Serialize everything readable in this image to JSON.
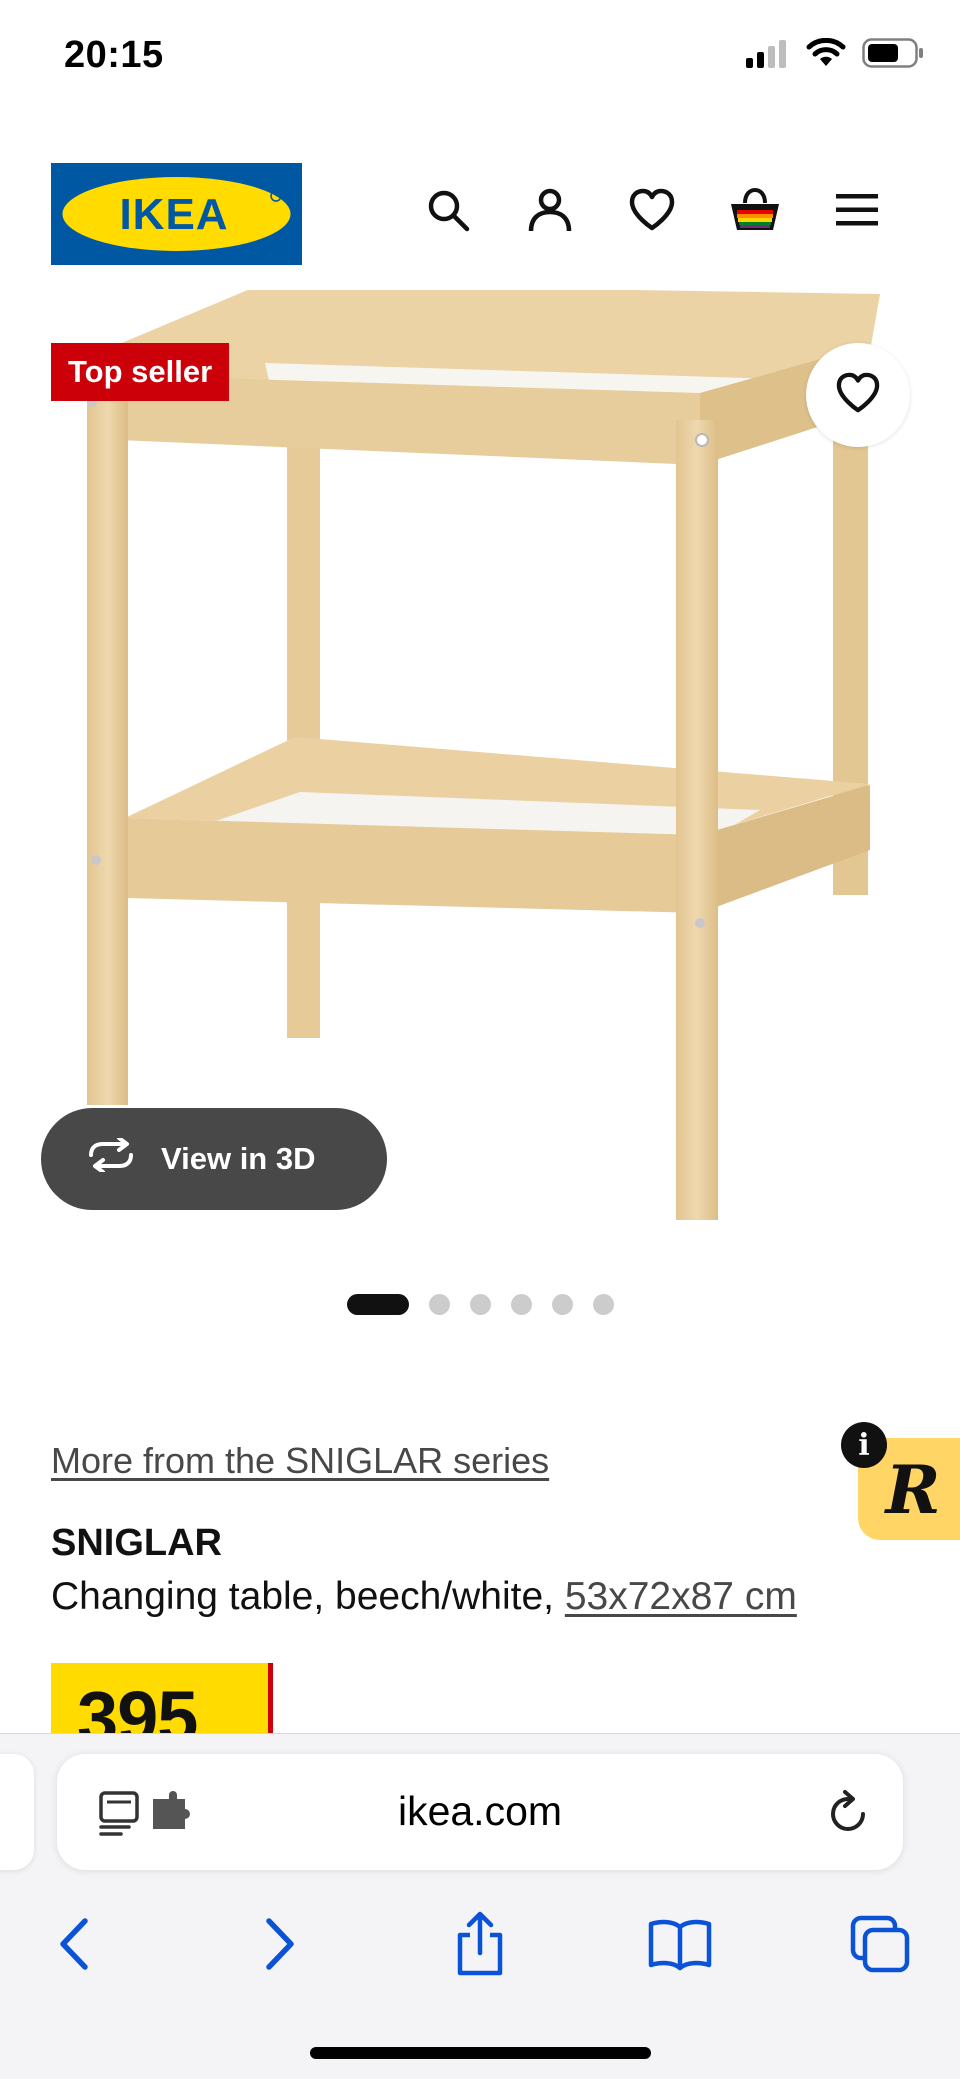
{
  "status_bar": {
    "time": "20:15",
    "icons": [
      "cellular-signal-icon",
      "wifi-icon",
      "battery-icon"
    ]
  },
  "header": {
    "logo_text": "IKEA",
    "icons": [
      "search-icon",
      "profile-icon",
      "heart-icon",
      "shopping-bag-icon",
      "menu-icon"
    ]
  },
  "product_media": {
    "badge": "Top seller",
    "view_3d_label": "View in 3D",
    "carousel": {
      "total": 6,
      "active": 1
    }
  },
  "product": {
    "series_link": "More from the SNIGLAR series",
    "name": "SNIGLAR",
    "description": "Changing table, beech/white, ",
    "dimensions": "53x72x87 cm",
    "price": "395"
  },
  "plugin": {
    "info_glyph": "i",
    "letter": "R"
  },
  "browser": {
    "url": "ikea.com",
    "toolbar": [
      "back-icon",
      "forward-icon",
      "share-icon",
      "bookmarks-icon",
      "tabs-icon"
    ]
  },
  "colors": {
    "ikea_blue": "#0058a3",
    "ikea_yellow": "#ffdb00",
    "badge_red": "#cc0008",
    "safari_blue": "#0a53d6",
    "wood": "#e9cf9f"
  }
}
